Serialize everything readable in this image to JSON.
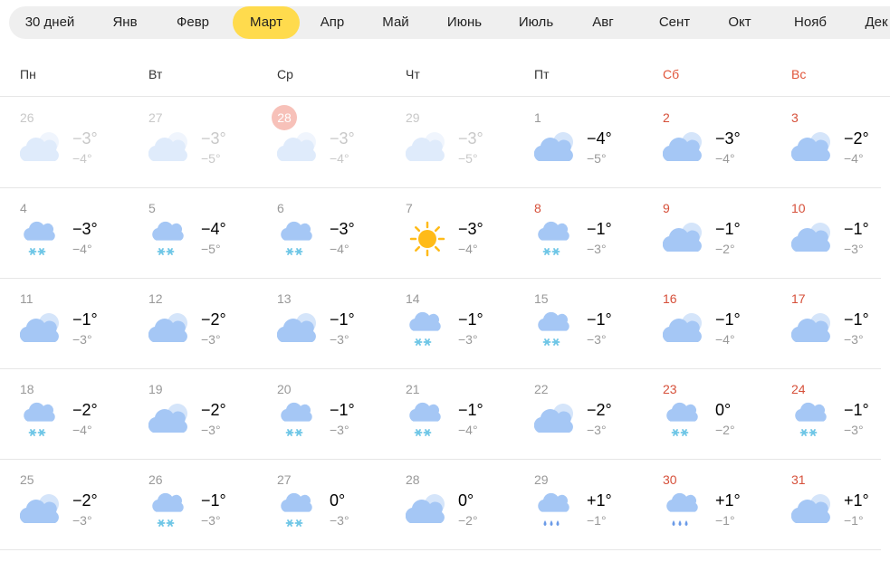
{
  "months": [
    "30 дней",
    "Янв",
    "Февр",
    "Март",
    "Апр",
    "Май",
    "Июнь",
    "Июль",
    "Авг",
    "Сент",
    "Окт",
    "Нояб",
    "Дек"
  ],
  "active_month": "Март",
  "weekdays": [
    "Пн",
    "Вт",
    "Ср",
    "Чт",
    "Пт",
    "Сб",
    "Вс"
  ],
  "colors": {
    "accent": "#ffdb4d",
    "weekend": "#e0553a",
    "today_bg": "#f7c1b9",
    "cloud": "#a5c7f5",
    "snow": "#6ec6e6",
    "sun": "#ffbb19"
  },
  "weeks": [
    [
      {
        "day": "26",
        "max": "−3°",
        "min": "−4°",
        "icon": "cloud-sun-icon",
        "past": true
      },
      {
        "day": "27",
        "max": "−3°",
        "min": "−5°",
        "icon": "cloud-sun-icon",
        "past": true
      },
      {
        "day": "28",
        "max": "−3°",
        "min": "−4°",
        "icon": "cloud-sun-icon",
        "past": true,
        "today": true
      },
      {
        "day": "29",
        "max": "−3°",
        "min": "−5°",
        "icon": "cloud-sun-icon",
        "past": true
      },
      {
        "day": "1",
        "max": "−4°",
        "min": "−5°",
        "icon": "cloud-sun-icon"
      },
      {
        "day": "2",
        "max": "−3°",
        "min": "−4°",
        "icon": "cloud-sun-icon",
        "weekend": true
      },
      {
        "day": "3",
        "max": "−2°",
        "min": "−4°",
        "icon": "cloud-sun-icon",
        "weekend": true
      }
    ],
    [
      {
        "day": "4",
        "max": "−3°",
        "min": "−4°",
        "icon": "cloud-snow-icon"
      },
      {
        "day": "5",
        "max": "−4°",
        "min": "−5°",
        "icon": "cloud-snow-icon"
      },
      {
        "day": "6",
        "max": "−3°",
        "min": "−4°",
        "icon": "cloud-snow-icon"
      },
      {
        "day": "7",
        "max": "−3°",
        "min": "−4°",
        "icon": "sun-icon"
      },
      {
        "day": "8",
        "max": "−1°",
        "min": "−3°",
        "icon": "cloud-snow-icon",
        "weekend": true
      },
      {
        "day": "9",
        "max": "−1°",
        "min": "−2°",
        "icon": "cloud-sun-icon",
        "weekend": true
      },
      {
        "day": "10",
        "max": "−1°",
        "min": "−3°",
        "icon": "cloud-sun-icon",
        "weekend": true
      }
    ],
    [
      {
        "day": "11",
        "max": "−1°",
        "min": "−3°",
        "icon": "cloud-sun-icon"
      },
      {
        "day": "12",
        "max": "−2°",
        "min": "−3°",
        "icon": "cloud-sun-icon"
      },
      {
        "day": "13",
        "max": "−1°",
        "min": "−3°",
        "icon": "cloud-sun-icon"
      },
      {
        "day": "14",
        "max": "−1°",
        "min": "−3°",
        "icon": "cloud-snow-icon"
      },
      {
        "day": "15",
        "max": "−1°",
        "min": "−3°",
        "icon": "cloud-snow-icon"
      },
      {
        "day": "16",
        "max": "−1°",
        "min": "−4°",
        "icon": "cloud-sun-icon",
        "weekend": true
      },
      {
        "day": "17",
        "max": "−1°",
        "min": "−3°",
        "icon": "cloud-sun-icon",
        "weekend": true
      }
    ],
    [
      {
        "day": "18",
        "max": "−2°",
        "min": "−4°",
        "icon": "cloud-snow-icon"
      },
      {
        "day": "19",
        "max": "−2°",
        "min": "−3°",
        "icon": "cloud-sun-icon"
      },
      {
        "day": "20",
        "max": "−1°",
        "min": "−3°",
        "icon": "cloud-snow-icon"
      },
      {
        "day": "21",
        "max": "−1°",
        "min": "−4°",
        "icon": "cloud-snow-icon"
      },
      {
        "day": "22",
        "max": "−2°",
        "min": "−3°",
        "icon": "cloud-sun-icon"
      },
      {
        "day": "23",
        "max": "0°",
        "min": "−2°",
        "icon": "cloud-snow-icon",
        "weekend": true
      },
      {
        "day": "24",
        "max": "−1°",
        "min": "−3°",
        "icon": "cloud-snow-icon",
        "weekend": true
      }
    ],
    [
      {
        "day": "25",
        "max": "−2°",
        "min": "−3°",
        "icon": "cloud-sun-icon"
      },
      {
        "day": "26",
        "max": "−1°",
        "min": "−3°",
        "icon": "cloud-snow-icon"
      },
      {
        "day": "27",
        "max": "0°",
        "min": "−3°",
        "icon": "cloud-snow-icon"
      },
      {
        "day": "28",
        "max": "0°",
        "min": "−2°",
        "icon": "cloud-sun-icon"
      },
      {
        "day": "29",
        "max": "+1°",
        "min": "−1°",
        "icon": "cloud-rain-icon"
      },
      {
        "day": "30",
        "max": "+1°",
        "min": "−1°",
        "icon": "cloud-rain-icon",
        "weekend": true
      },
      {
        "day": "31",
        "max": "+1°",
        "min": "−1°",
        "icon": "cloud-sun-icon",
        "weekend": true
      }
    ]
  ]
}
